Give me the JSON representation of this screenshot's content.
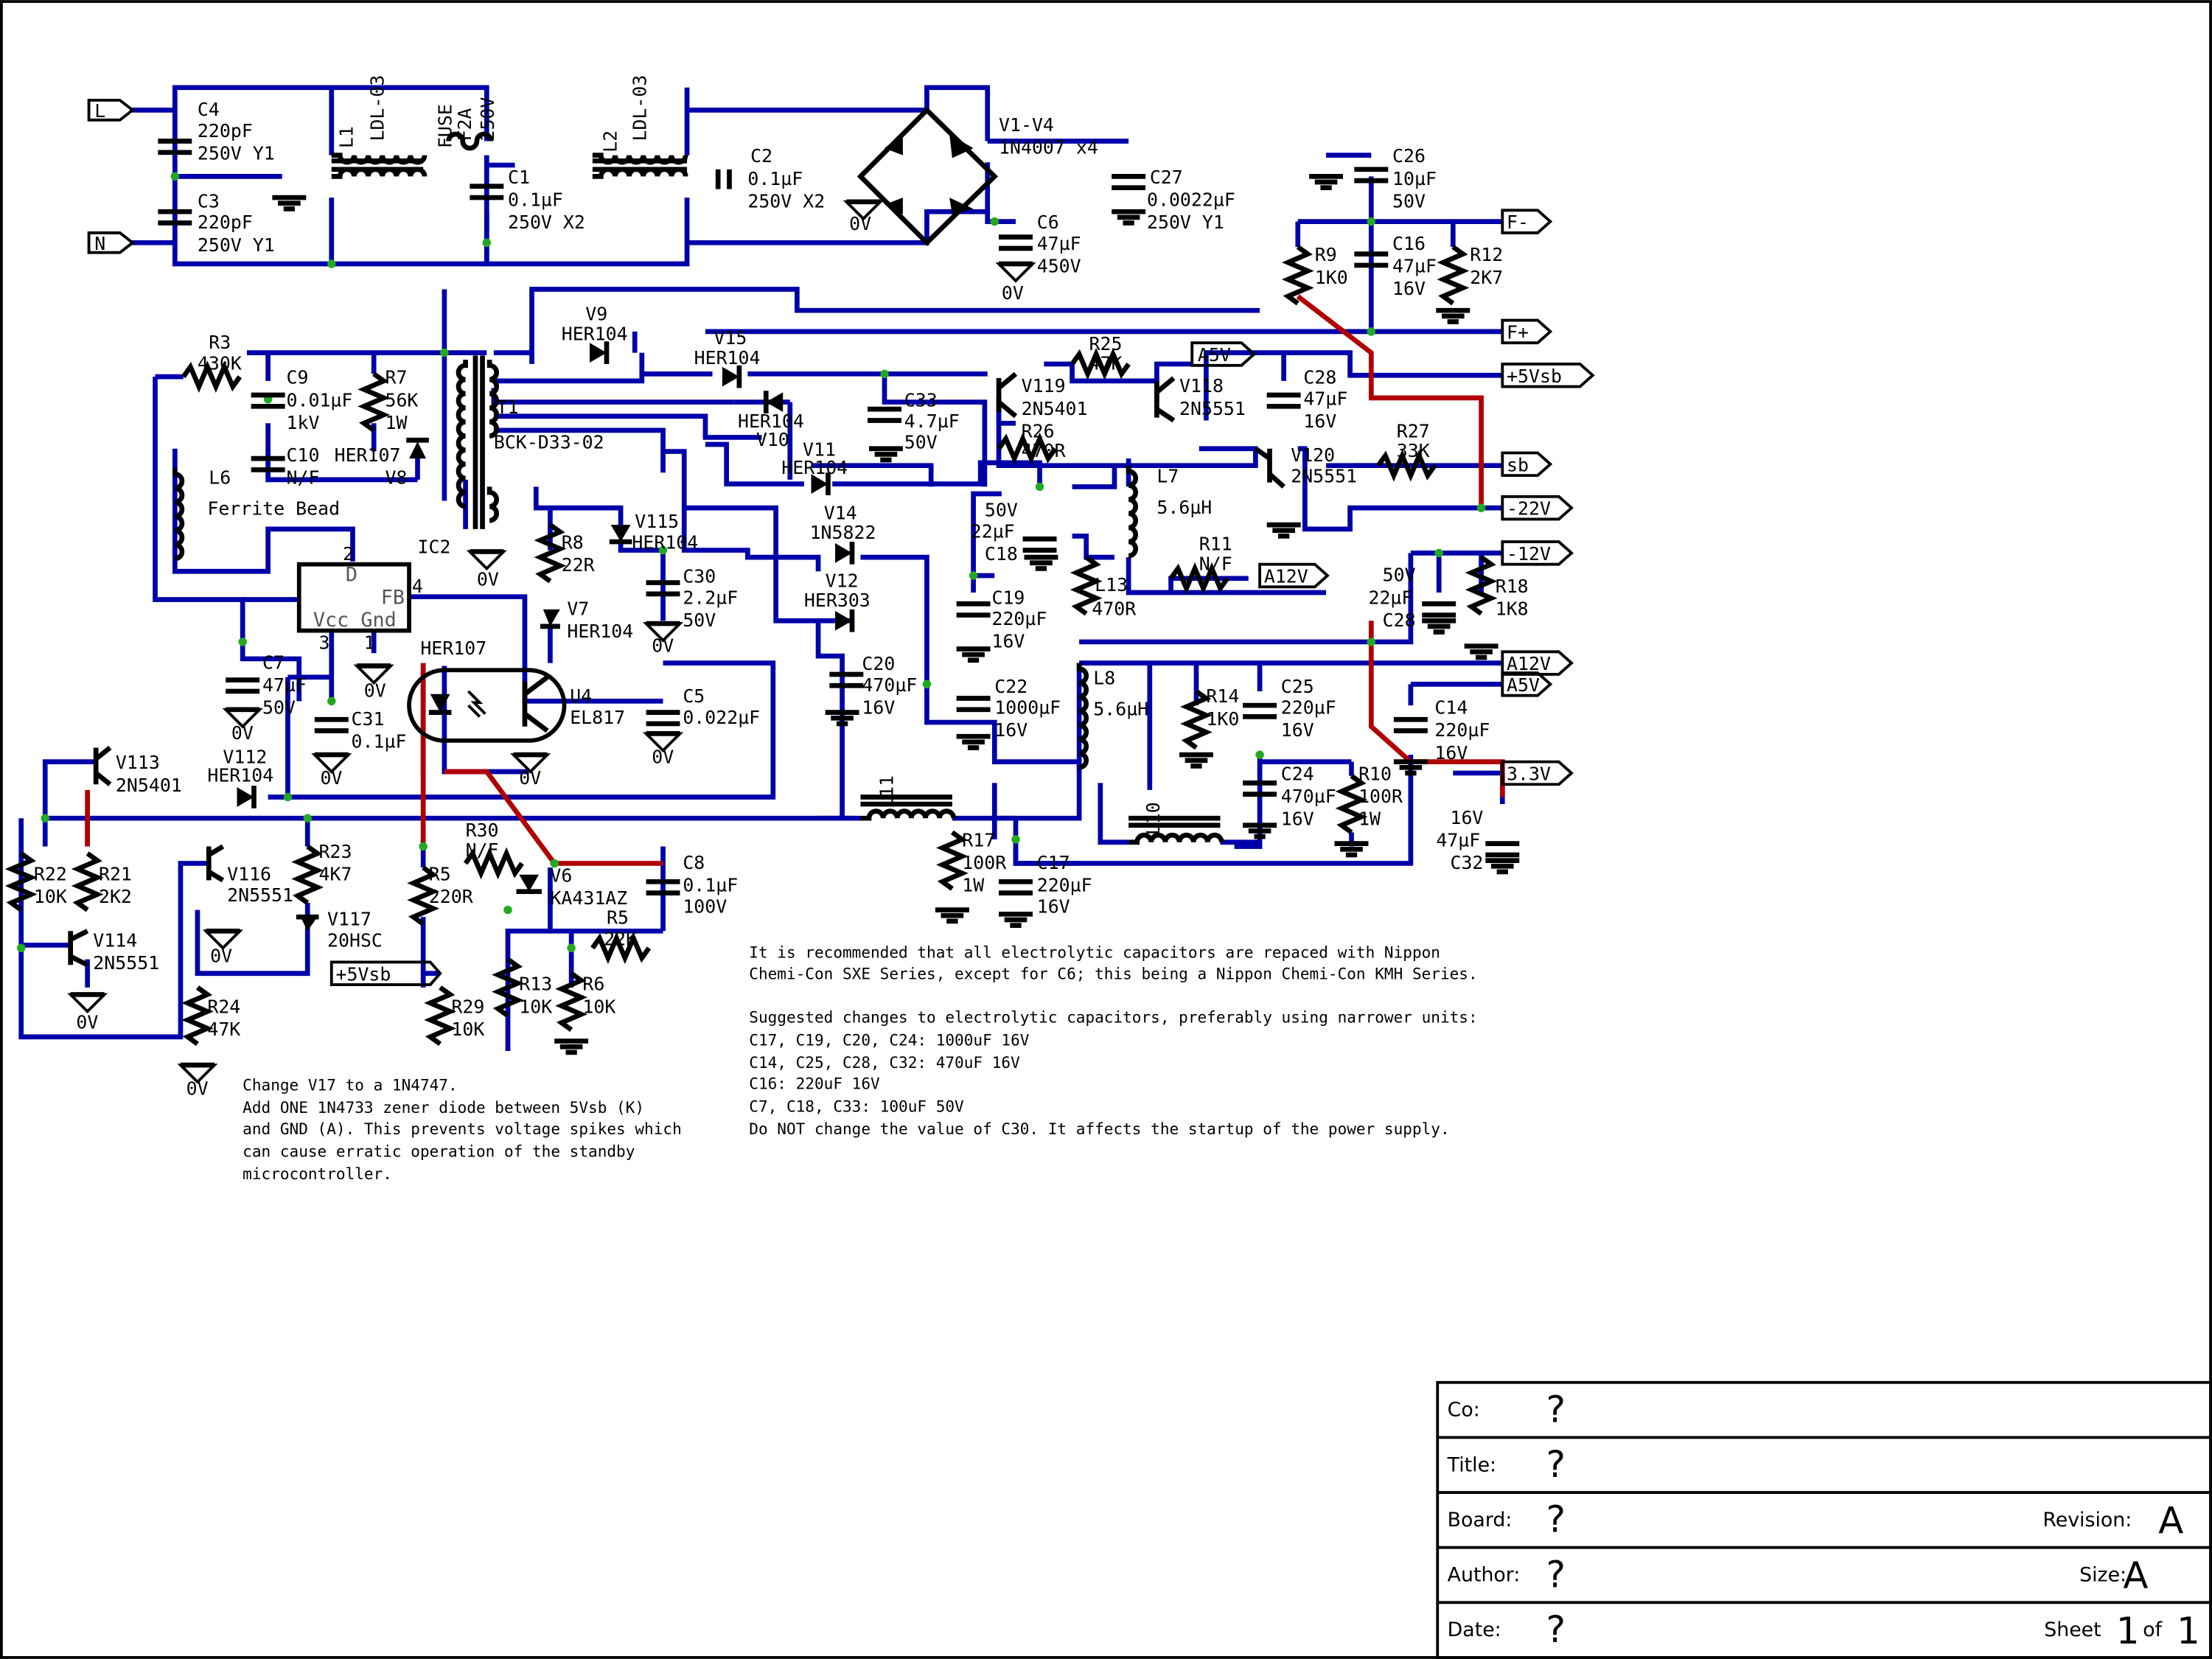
{
  "labels": {
    "C4": "C4",
    "C4_val": "220pF",
    "C4_rating": "250V Y1",
    "C3": "C3",
    "C3_val": "220pF",
    "C3_rating": "250V Y1",
    "L1": "L1",
    "L1_part": "LDL-03",
    "FUSE": "FUSE",
    "FUSE_val": "F2A",
    "FUSE_rating": "250V",
    "C1": "C1",
    "C1_val": "0.1µF",
    "C1_rating": "250V X2",
    "L2": "L2",
    "L2_part": "LDL-03",
    "C2": "C2",
    "C2_val": "0.1µF",
    "C2_rating": "250V X2",
    "V1V4": "V1-V4",
    "V1V4_part": "1N4007 x4",
    "C27": "C27",
    "C27_val": "0.0022µF",
    "C27_rating": "250V Y1",
    "C6": "C6",
    "C6_val": "47µF",
    "C6_rating": "450V",
    "C26": "C26",
    "C26_val": "10µF",
    "C26_rating": "50V",
    "R9": "R9",
    "R9_val": "1K0",
    "C16": "C16",
    "C16_val": "47µF",
    "C16_rating": "16V",
    "R12": "R12",
    "R12_val": "2K7",
    "R3": "R3",
    "R3_val": "430K",
    "C9": "C9",
    "C9_val": "0.01µF",
    "C9_rating": "1kV",
    "R7": "R7",
    "R7_val": "56K",
    "R7_rating": "1W",
    "C10": "C10",
    "C10_val": "N/F",
    "HER107a": "HER107",
    "V8": "V8",
    "L6": "L6",
    "L6_desc": "Ferrite Bead",
    "T1": "T1",
    "T1_part": "BCK-D33-02",
    "V9": "V9",
    "V9_part": "HER104",
    "V15": "V15",
    "V15_part": "HER104",
    "V10": "V10",
    "V10_part": "HER104",
    "V11": "V11",
    "V11_part": "HER104",
    "V115": "V115",
    "V115_part": "HER104",
    "V14": "V14",
    "V14_part": "1N5822",
    "V12": "V12",
    "V12_part": "HER303",
    "R25": "R25",
    "R25_val": "47K",
    "V119": "V119",
    "V119_part": "2N5401",
    "V118": "V118",
    "V118_part": "2N5551",
    "R26": "R26",
    "R26_val": "470R",
    "C28a": "C28",
    "C28a_val": "47µF",
    "C28a_rating": "16V",
    "R27": "R27",
    "R27_val": "33K",
    "V120": "V120",
    "V120_part": "2N5551",
    "C33": "C33",
    "C33_val": "4.7µF",
    "C33_rating": "50V",
    "C18": "C18",
    "C18_val": "22µF",
    "C18_rating": "50V",
    "L7": "L7",
    "L7_val": "5.6µH",
    "R11": "R11",
    "R11_val": "N/F",
    "L13": "L13",
    "L13_val": "470R",
    "C19": "C19",
    "C19_val": "220µF",
    "C19_rating": "16V",
    "C28b": "C28",
    "C28b_val": "22µF",
    "C28b_rating": "50V",
    "R18": "R18",
    "R18_val": "1K8",
    "R8": "R8",
    "R8_val": "22R",
    "C30": "C30",
    "C30_val": "2.2µF",
    "C30_rating": "50V",
    "V7": "V7",
    "V7_part": "HER104",
    "IC2": "IC2",
    "IC2_D": "D",
    "IC2_FB": "FB",
    "IC2_VccGnd": "Vcc Gnd",
    "pin2": "2",
    "pin3": "3",
    "pin1": "1",
    "pin4": "4",
    "HER107b": "HER107",
    "U4": "U4",
    "U4_part": "EL817",
    "C5": "C5",
    "C5_val": "0.022µF",
    "C7": "C7",
    "C7_val": "47µF",
    "C7_rating": "50V",
    "C31": "C31",
    "C31_val": "0.1µF",
    "C20": "C20",
    "C20_val": "470µF",
    "C20_rating": "16V",
    "C22": "C22",
    "C22_val": "1000µF",
    "C22_rating": "16V",
    "L8": "L8",
    "L8_val": "5.6µH",
    "R14": "R14",
    "R14_val": "1K0",
    "C25": "C25",
    "C25_val": "220µF",
    "C25_rating": "16V",
    "C14": "C14",
    "C14_val": "220µF",
    "C14_rating": "16V",
    "C24": "C24",
    "C24_val": "470µF",
    "C24_rating": "16V",
    "R10": "R10",
    "R10_val": "100R",
    "R10_rating": "1W",
    "C32": "C32",
    "C32_val": "47µF",
    "C32_rating": "16V",
    "V113": "V113",
    "V113_part": "2N5401",
    "V112": "V112",
    "V112_part": "HER104",
    "L11": "L11",
    "L10": "L10",
    "R17": "R17",
    "R17_val": "100R",
    "R17_rating": "1W",
    "C17": "C17",
    "C17_val": "220µF",
    "C17_rating": "16V",
    "R30": "R30",
    "R30_val": "N/F",
    "V6": "V6",
    "V6_part": "KA431AZ",
    "C8": "C8",
    "C8_val": "0.1µF",
    "C8_rating": "100V",
    "R22": "R22",
    "R22_val": "10K",
    "R21": "R21",
    "R21_val": "2K2",
    "V116": "V116",
    "V116_part": "2N5551",
    "R23": "R23",
    "R23_val": "4K7",
    "V117": "V117",
    "V117_part": "20HSC",
    "R5a": "R5",
    "R5a_val": "220R",
    "R5b": "R5",
    "R5b_val": "22K",
    "V114": "V114",
    "V114_part": "2N5551",
    "R24": "R24",
    "R24_val": "47K",
    "R13": "R13",
    "R13_val": "10K",
    "R6": "R6",
    "R6_val": "10K",
    "R29": "R29",
    "R29_val": "10K",
    "ground": "0V"
  },
  "ports": {
    "L": "L",
    "N": "N",
    "Fminus": "F-",
    "Fplus": "F+",
    "A5V_top": "A5V",
    "p5Vsb_top": "+5Vsb",
    "sb": "sb",
    "m22V": "-22V",
    "m12V": "-12V",
    "A12V_mid": "A12V",
    "A12V_right": "A12V",
    "A5V_right": "A5V",
    "p33V": "3.3V",
    "p5Vsb_bottom": "+5Vsb"
  },
  "notes": {
    "left": [
      "Change V17 to a 1N4747.",
      "Add ONE 1N4733 zener diode between 5Vsb (K)",
      "and GND (A). This prevents voltage spikes which",
      "can cause erratic operation of the standby",
      "microcontroller."
    ],
    "right": [
      "It is recommended that all electrolytic capacitors are repaced with Nippon",
      "Chemi-Con SXE Series, except for C6; this being a Nippon Chemi-Con KMH Series.",
      "",
      "Suggested changes to electrolytic capacitors, preferably using narrower units:",
      "C17, C19, C20, C24: 1000uF 16V",
      "C14, C25, C28, C32: 470uF 16V",
      "C16: 220uF 16V",
      "C7, C18, C33: 100uF 50V",
      "Do NOT change the value of C30. It affects the startup of the power supply."
    ]
  },
  "title_block": {
    "co_label": "Co:",
    "co_value": "?",
    "title_label": "Title:",
    "title_value": "?",
    "board_label": "Board:",
    "board_value": "?",
    "revision_label": "Revision:",
    "revision_value": "A",
    "author_label": "Author:",
    "author_value": "?",
    "size_label": "Size:",
    "size_value": "A",
    "date_label": "Date:",
    "date_value": "?",
    "sheet_label": "Sheet",
    "sheet_num": "1",
    "sheet_of": "of",
    "sheet_total": "1"
  },
  "colors": {
    "wire": "#0000aa",
    "modwire": "#b00000",
    "junction": "#22aa22"
  }
}
